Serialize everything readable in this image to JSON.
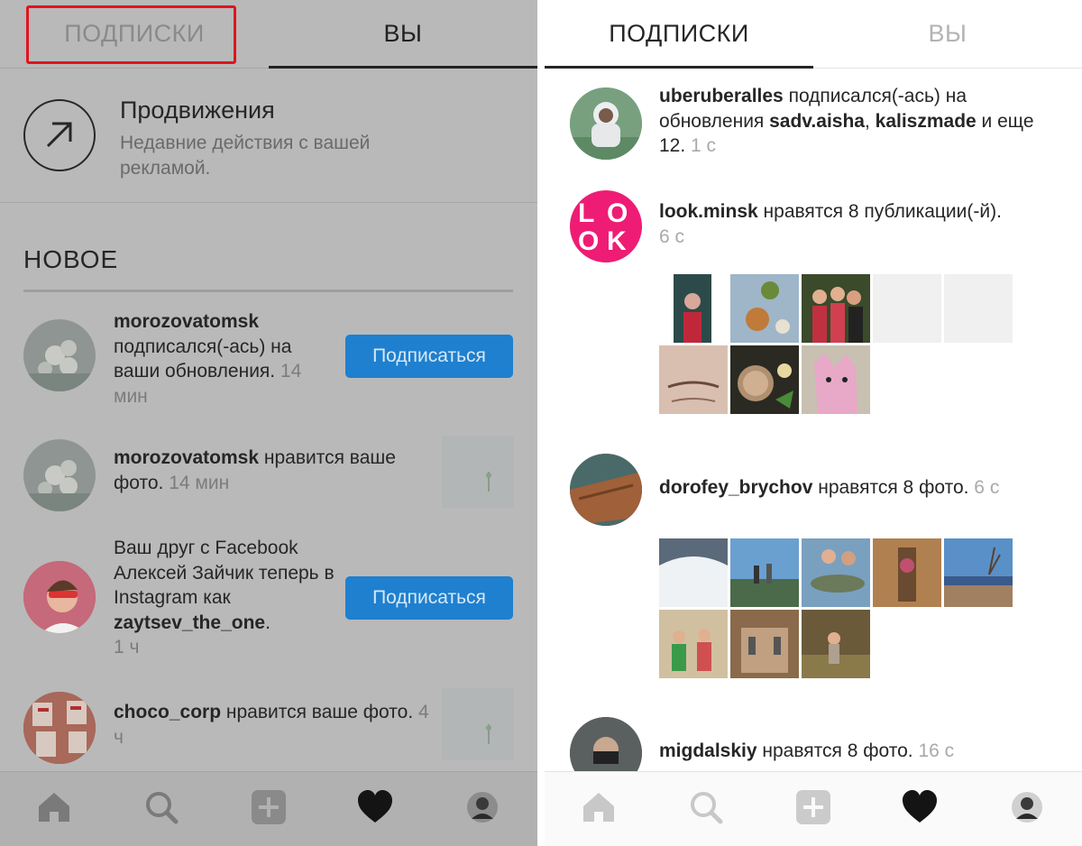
{
  "left": {
    "tabs": {
      "following": "ПОДПИСКИ",
      "you": "ВЫ"
    },
    "promo": {
      "title": "Продвижения",
      "description": "Недавние действия с вашей рекламой."
    },
    "section_title": "НОВОЕ",
    "notifications": [
      {
        "user": "morozovatomsk",
        "text": " подписался(-ась) на ваши обновления.",
        "time": " 14 мин",
        "button": "Подписаться"
      },
      {
        "user": "morozovatomsk",
        "text": " нравится ваше фото.",
        "time": " 14 мин"
      },
      {
        "prefix": "Ваш друг с Facebook Алексей Зайчик теперь в Instagram как ",
        "user": "zaytsev_the_one",
        "text": ".",
        "time": "1 ч",
        "button": "Подписаться"
      },
      {
        "user": "choco_corp",
        "text": " нравится ваше фото.",
        "time": " 4 ч"
      }
    ]
  },
  "right": {
    "tabs": {
      "following": "ПОДПИСКИ",
      "you": "ВЫ"
    },
    "feed": [
      {
        "user": "uberuberalles",
        "text1": " подписался(-ась) на обновления ",
        "user2": "sadv.aisha",
        "sep": ", ",
        "user3": "kaliszmade",
        "text2": " и еще 12.",
        "time": " 1 с"
      },
      {
        "user": "look.minsk",
        "text": " нравятся 8 публикации(-й).",
        "time": "6 с",
        "logo": [
          "L",
          "O",
          "O",
          "K"
        ]
      },
      {
        "user": "dorofey_brychov",
        "text": " нравятся 8 фото.",
        "time": " 6 с"
      },
      {
        "user": "migdalskiy",
        "text": " нравятся 8 фото.",
        "time": " 16 с"
      }
    ]
  },
  "icons": [
    "home-icon",
    "search-icon",
    "add-icon",
    "heart-icon",
    "profile-icon"
  ],
  "colors": {
    "follow_button": "#1e80cf",
    "highlight": "#e0141e",
    "look_pink": "#ee1c74"
  }
}
